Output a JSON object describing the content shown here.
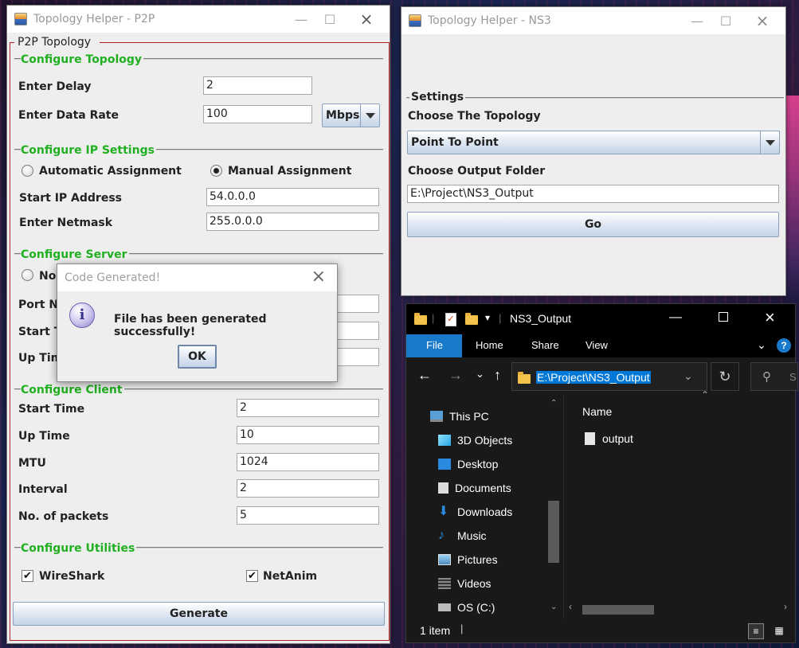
{
  "p2p_window": {
    "title": "Topology Helper - P2P",
    "panel_title": "P2P Topology",
    "configure_topology": {
      "title": "Configure Topology",
      "delay_label": "Enter Delay",
      "delay_value": "2",
      "rate_label": "Enter Data Rate",
      "rate_value": "100",
      "rate_unit": "Mbps"
    },
    "configure_ip": {
      "title": "Configure IP Settings",
      "auto_label": "Automatic Assignment",
      "manual_label": "Manual Assignment",
      "selected": "manual",
      "start_ip_label": "Start IP Address",
      "start_ip_value": "54.0.0.0",
      "netmask_label": "Enter Netmask",
      "netmask_value": "255.0.0.0"
    },
    "configure_server": {
      "title": "Configure Server",
      "node_label_partial": "Nod",
      "port_label_partial": "Port Nu",
      "start_label_partial": "Start Ti",
      "up_label_partial": "Up Tim"
    },
    "configure_client": {
      "title": "Configure Client",
      "start_time_label": "Start Time",
      "start_time_value": "2",
      "up_time_label": "Up Time",
      "up_time_value": "10",
      "mtu_label": "MTU",
      "mtu_value": "1024",
      "interval_label": "Interval",
      "interval_value": "2",
      "packets_label": "No. of packets",
      "packets_value": "5"
    },
    "configure_utilities": {
      "title": "Configure Utilities",
      "wireshark_label": "WireShark",
      "netanim_label": "NetAnim",
      "wireshark_checked": true,
      "netanim_checked": true
    },
    "generate_label": "Generate"
  },
  "dialog": {
    "title": "Code Generated!",
    "message": "File has been generated successfully!",
    "ok_label": "OK",
    "icon": "info-icon"
  },
  "ns3_window": {
    "title": "Topology Helper - NS3",
    "settings_title": "Settings",
    "choose_topology_label": "Choose The Topology",
    "topology_value": "Point To Point",
    "choose_folder_label": "Choose Output Folder",
    "folder_value": "E:\\Project\\NS3_Output",
    "go_label": "Go"
  },
  "explorer": {
    "title": "NS3_Output",
    "ribbon_tabs": [
      "File",
      "Home",
      "Share",
      "View"
    ],
    "address": "E:\\Project\\NS3_Output",
    "search_partial": "S",
    "nav_items": [
      "This PC",
      "3D Objects",
      "Desktop",
      "Documents",
      "Downloads",
      "Music",
      "Pictures",
      "Videos",
      "OS (C:)"
    ],
    "column_name": "Name",
    "files": [
      "output"
    ],
    "status": "1 item",
    "colors": {
      "file_tab": "#1979ca",
      "address_highlight": "#0078d7"
    }
  }
}
